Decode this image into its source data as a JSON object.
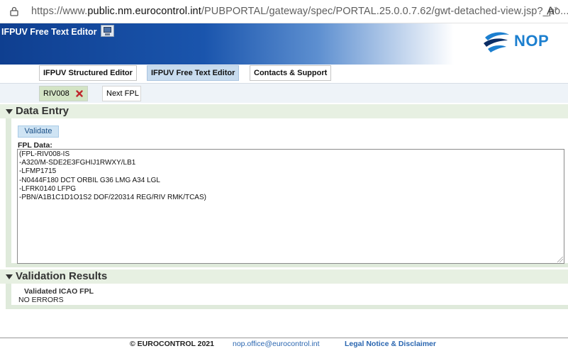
{
  "browser": {
    "url_prefix": "https://www.",
    "url_host": "public.nm.eurocontrol.int",
    "url_path": "/PUBPORTAL/gateway/spec/PORTAL.25.0.0.7.62/gwt-detached-view.jsp?_po..."
  },
  "header": {
    "title": "IFPUV Free Text Editor",
    "logo_text": "NOP"
  },
  "tabs": [
    {
      "label": "IFPUV Structured Editor"
    },
    {
      "label": "IFPUV Free Text Editor"
    },
    {
      "label": "Contacts & Support"
    }
  ],
  "subtabs": {
    "riv": "RIV008",
    "next": "Next FPL"
  },
  "data_entry": {
    "title": "Data Entry",
    "validate_label": "Validate",
    "fpl_label": "FPL Data:",
    "fpl_lines": [
      "(FPL-RIV008-IS",
      "-A320/M-SDE2E3FGHIJ1RWXY/LB1",
      "-LFMP1715",
      "-N0444F180 DCT ORBIL G36 LMG A34 LGL",
      "-LFRK0140 LFPG",
      "-PBN/A1B1C1D1O1S2 DOF/220314 REG/RIV RMK/TCAS)"
    ]
  },
  "validation": {
    "title": "Validation Results",
    "subtitle": "Validated ICAO FPL",
    "message": "NO ERRORS"
  },
  "footer": {
    "copyright": "© EUROCONTROL 2021",
    "email": "nop.office@eurocontrol.int",
    "legal": "Legal Notice & Disclaimer"
  },
  "colors": {
    "banner_blue": "#1a55ad",
    "logo_blue": "#1c7fcf",
    "section_green": "#e7f0e2"
  }
}
